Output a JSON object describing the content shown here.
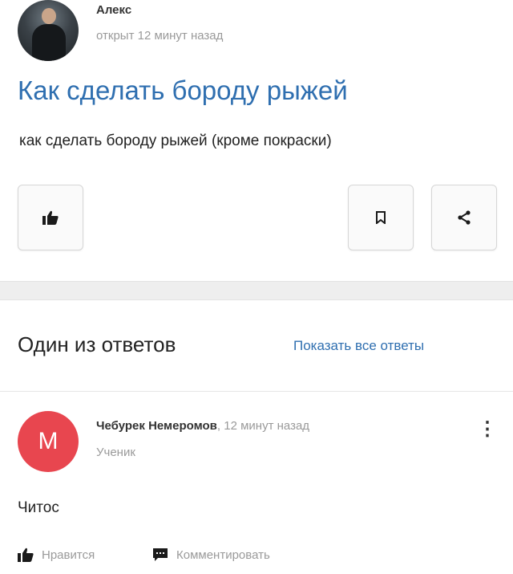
{
  "question": {
    "author_name": "Алекс",
    "posted_time": "открыт 12 минут назад",
    "title": "Как сделать бороду рыжей",
    "body": "как сделать бороду рыжей (кроме покраски)",
    "actions": {
      "like_icon": "thumbs-up-icon",
      "bookmark_icon": "bookmark-icon",
      "share_icon": "share-icon"
    }
  },
  "answers_section": {
    "heading": "Один из ответов",
    "show_all_label": "Показать все ответы"
  },
  "answer": {
    "avatar_letter": "М",
    "author_name": "Чебурек Немеромов",
    "separator": ",",
    "time": "12 минут назад",
    "rank": "Ученик",
    "text": "Читос",
    "like_label": "Нравится",
    "comment_label": "Комментировать"
  },
  "colors": {
    "link": "#2f6fb0",
    "avatar_bg": "#e8464f",
    "muted": "#9a9a9a"
  }
}
